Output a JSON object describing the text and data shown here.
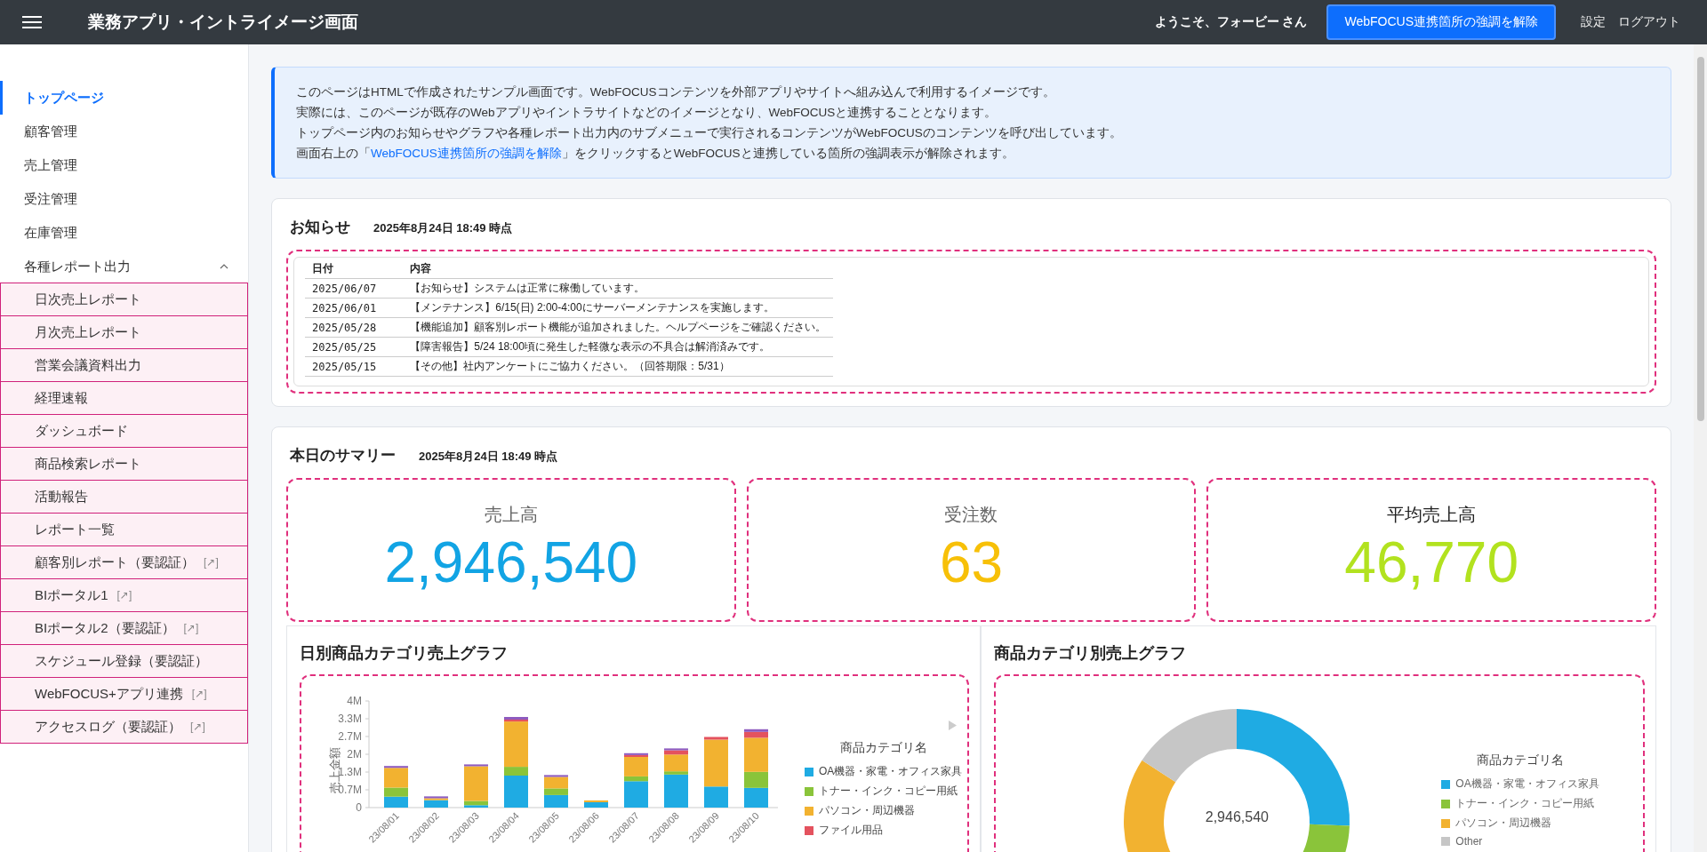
{
  "header": {
    "title": "業務アプリ・イントライメージ画面",
    "welcome": "ようこそ、フォービー さん",
    "highlight_button": "WebFOCUS連携箇所の強調を解除",
    "links": [
      "設定",
      "ログアウト"
    ]
  },
  "sidebar": {
    "items": [
      {
        "label": "トップページ",
        "selected": true
      },
      {
        "label": "顧客管理",
        "selected": false
      },
      {
        "label": "売上管理",
        "selected": false
      },
      {
        "label": "受注管理",
        "selected": false
      },
      {
        "label": "在庫管理",
        "selected": false
      },
      {
        "label": "各種レポート出力",
        "selected": false,
        "expanded": true,
        "children": [
          {
            "label": "日次売上レポート",
            "selected": false
          },
          {
            "label": "月次売上レポート",
            "selected": false
          },
          {
            "label": "営業会議資料出力",
            "selected": false
          },
          {
            "label": "経理速報",
            "selected": false
          },
          {
            "label": "ダッシュボード",
            "selected": false
          },
          {
            "label": "商品検索レポート",
            "selected": false
          },
          {
            "label": "活動報告",
            "selected": false
          },
          {
            "label": "レポート一覧",
            "selected": false
          },
          {
            "label": "顧客別レポート（要認証）",
            "selected": false,
            "mark": "[↗]"
          },
          {
            "label": "BIポータル1",
            "selected": false,
            "mark": "[↗]"
          },
          {
            "label": "BIポータル2（要認証）",
            "selected": false,
            "mark": "[↗]"
          },
          {
            "label": "スケジュール登録（要認証）",
            "selected": false
          },
          {
            "label": "WebFOCUS+アプリ連携",
            "selected": false,
            "mark": "[↗]"
          },
          {
            "label": "アクセスログ（要認証）",
            "selected": false,
            "mark": "[↗]"
          }
        ]
      }
    ]
  },
  "info": {
    "lines": [
      "このページはHTMLで作成されたサンプル画面です。WebFOCUSコンテンツを外部アプリやサイトへ組み込んで利用するイメージです。",
      "実際には、このページが既存のWebアプリやイントラサイトなどのイメージとなり、WebFOCUSと連携することとなります。",
      "トップページ内のお知らせやグラフや各種レポート出力内のサブメニューで実行されるコンテンツがWebFOCUSのコンテンツを呼び出しています。"
    ],
    "last_line": {
      "before": "画面右上の「",
      "link": "WebFOCUS連携箇所の強調を解除",
      "after": "」をクリックするとWebFOCUSと連携している箇所の強調表示が解除されます。"
    }
  },
  "notice": {
    "title": "お知らせ",
    "timestamp": "2025年8月24日 18:49 時点",
    "table": {
      "columns": [
        "日付",
        "内容"
      ],
      "rows": [
        [
          "2025/06/07",
          "【お知らせ】システムは正常に稼働しています。"
        ],
        [
          "2025/06/01",
          "【メンテナンス】6/15(日) 2:00-4:00にサーバーメンテナンスを実施します。"
        ],
        [
          "2025/05/28",
          "【機能追加】顧客別レポート機能が追加されました。ヘルプページをご確認ください。"
        ],
        [
          "2025/05/25",
          "【障害報告】5/24 18:00頃に発生した軽微な表示の不具合は解消済みです。"
        ],
        [
          "2025/05/15",
          "【その他】社内アンケートにご協力ください。（回答期限：5/31）"
        ]
      ]
    }
  },
  "summary": {
    "title": "本日のサマリー",
    "timestamp": "2025年8月24日 18:49 時点",
    "stats": [
      {
        "label": "売上高",
        "value": "2,946,540",
        "color": "#12a4e4"
      },
      {
        "label": "受注数",
        "value": "63",
        "color": "#f7c008"
      },
      {
        "label": "平均売上高",
        "value": "46,770",
        "color": "#b2e21f"
      }
    ]
  },
  "bar_chart": {
    "title": "日別商品カテゴリ売上グラフ",
    "legend_title": "商品カテゴリ名",
    "chart_data": {
      "type": "bar",
      "stacked": true,
      "ylabel": "売上金額",
      "categories": [
        "23/08/01",
        "23/08/02",
        "23/08/03",
        "23/08/04",
        "23/08/05",
        "23/08/06",
        "23/08/07",
        "23/08/08",
        "23/08/09",
        "23/08/10"
      ],
      "ylim": [
        0,
        4
      ],
      "yticks": [
        0,
        {
          "value": 0.667,
          "label": "0.7M"
        },
        {
          "value": 1.333,
          "label": "1.3M"
        },
        {
          "value": 2,
          "label": "2M"
        },
        {
          "value": 2.667,
          "label": "2.7M"
        },
        {
          "value": 3.333,
          "label": "3.3M"
        },
        {
          "value": 4,
          "label": "4M"
        }
      ],
      "series": [
        {
          "name": "OA機器・家電・オフィス家具",
          "color": "#1fabe3",
          "values": [
            0.41,
            0.28,
            0.09,
            1.2,
            0.47,
            0.2,
            0.99,
            1.24,
            0.79,
            0.74
          ]
        },
        {
          "name": "トナー・インク・コピー用紙",
          "color": "#8ac43a",
          "values": [
            0.34,
            0,
            0.16,
            0.33,
            0.25,
            0,
            0.18,
            0.12,
            0,
            0.6
          ]
        },
        {
          "name": "パソコン・周辺機器",
          "color": "#f2b230",
          "values": [
            0.74,
            0.07,
            1.3,
            1.7,
            0.43,
            0.07,
            0.73,
            0.63,
            1.76,
            1.28
          ]
        },
        {
          "name": "ファイル用品",
          "color": "#e4525e",
          "values": [
            0,
            0,
            0,
            0.07,
            0,
            0,
            0.07,
            0.16,
            0.1,
            0.22
          ]
        },
        {
          "color": "#8e5bbf",
          "values": [
            0.07,
            0.07,
            0.07,
            0.1,
            0.07,
            0,
            0.07,
            0.07,
            0,
            0.1
          ]
        }
      ],
      "legend": "right"
    }
  },
  "donut_chart": {
    "title": "商品カテゴリ別売上グラフ",
    "center_value": "2,946,540",
    "legend": {
      "title": "商品カテゴリ名",
      "items": [
        {
          "label": "OA機器・家電・オフィス家具",
          "color": "#1fabe3"
        },
        {
          "label": "トナー・インク・コピー用紙",
          "color": "#8ac43a"
        },
        {
          "label": "パソコン・周辺機器",
          "color": "#f2b230"
        },
        {
          "label": "Other",
          "color": "#c6c6c6"
        }
      ]
    }
  }
}
